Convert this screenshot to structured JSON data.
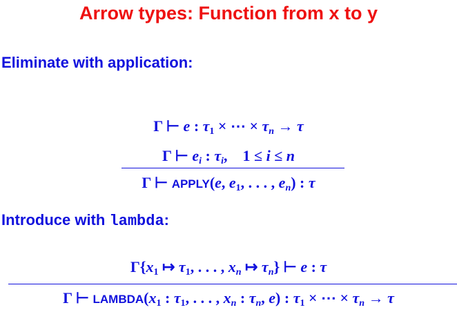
{
  "title": "Arrow types: Function from x to y",
  "elim_heading": "Eliminate with application:",
  "intro_heading_prefix": "Introduce with ",
  "intro_heading_code": "lambda",
  "intro_heading_suffix": ":",
  "apply_name": "APPLY",
  "lambda_name": "LAMBDA"
}
